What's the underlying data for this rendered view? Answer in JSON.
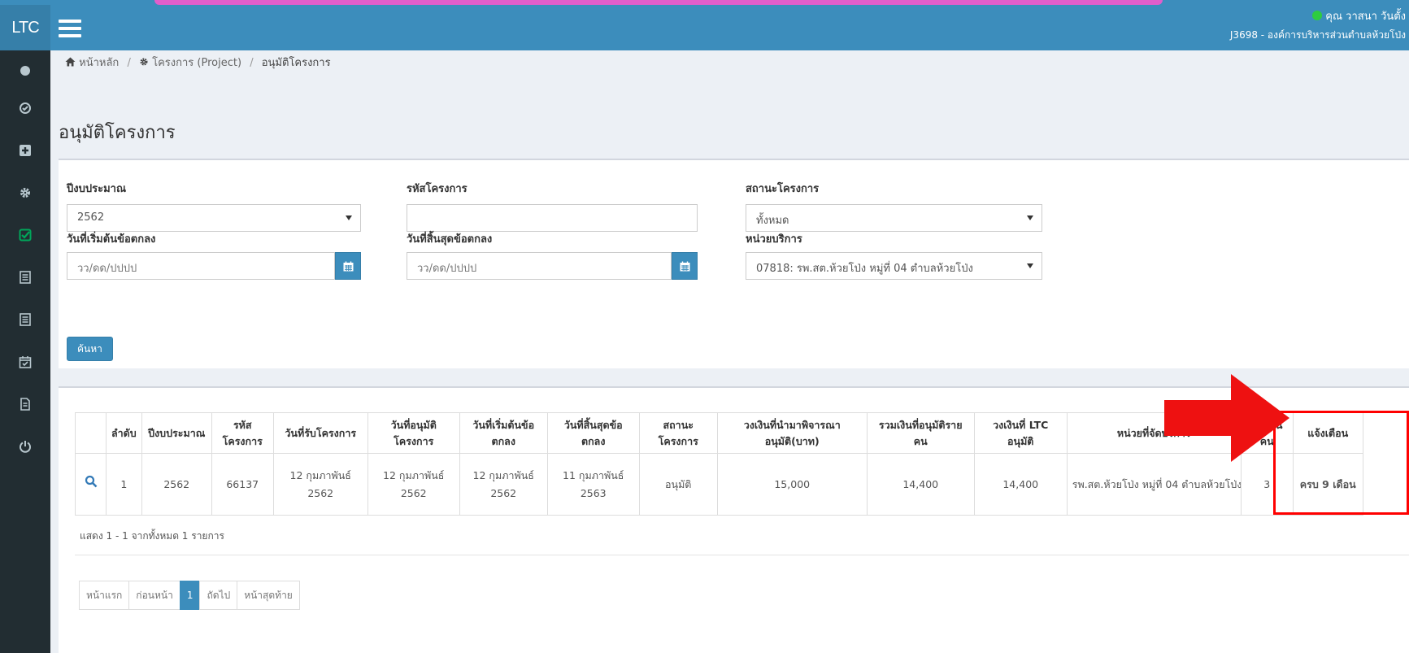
{
  "app": {
    "logo": "LTC"
  },
  "user": {
    "name": "คุณ วาสนา วันตั้ง",
    "org": "J3698 - องค์การบริหารส่วนตำบลห้วยโป่ง"
  },
  "sidebar": {
    "items": [
      {
        "icon": "circle-icon"
      },
      {
        "icon": "check-circle-icon"
      },
      {
        "icon": "plus-square-icon"
      },
      {
        "icon": "gear-icon"
      },
      {
        "icon": "check-square-icon",
        "active": true
      },
      {
        "icon": "list-icon"
      },
      {
        "icon": "list-alt-icon"
      },
      {
        "icon": "calendar-check-icon"
      },
      {
        "icon": "file-text-icon"
      },
      {
        "icon": "power-icon"
      }
    ]
  },
  "breadcrumb": {
    "home": "หน้าหลัก",
    "sep": "/",
    "project": "โครงการ (Project)",
    "current": "อนุมัติโครงการ"
  },
  "page": {
    "title": "อนุมัติโครงการ"
  },
  "filters": {
    "budget_year": {
      "label": "ปีงบประมาณ",
      "value": "2562"
    },
    "project_code": {
      "label": "รหัสโครงการ",
      "value": ""
    },
    "project_status": {
      "label": "สถานะโครงการ",
      "value": "ทั้งหมด"
    },
    "start_date": {
      "label": "วันที่เริ่มต้นข้อตกลง",
      "placeholder": "วว/ดด/ปปปป"
    },
    "end_date": {
      "label": "วันที่สิ้นสุดข้อตกลง",
      "placeholder": "วว/ดด/ปปปป"
    },
    "service_unit": {
      "label": "หน่วยบริการ",
      "value": "07818: รพ.สต.ห้วยโป่ง หมู่ที่ 04 ตำบลห้วยโป่ง"
    },
    "search_label": "ค้นหา"
  },
  "table": {
    "headers": {
      "no": "ลำดับ",
      "year": "ปีงบประมาณ",
      "code": "รหัสโครงการ",
      "received": "วันที่รับโครงการ",
      "approved": "วันที่อนุมัติโครงการ",
      "start": "วันที่เริ่มต้นข้อตกลง",
      "end": "วันที่สิ้นสุดข้อตกลง",
      "status": "สถานะโครงการ",
      "proposed": "วงเงินที่นำมาพิจารณาอนุมัติ(บาท)",
      "per_person": "รวมเงินที่อนุมัติรายคน",
      "ltc": "วงเงินที่ LTC อนุมัติ",
      "unit": "หน่วยที่จัดบริการ",
      "people": "จำนวนคน",
      "alert": "แจ้งเตือน"
    },
    "rows": [
      {
        "no": "1",
        "year": "2562",
        "code": "66137",
        "received": "12 กุมภาพันธ์ 2562",
        "approved_a": "12 กุมภาพันธ์",
        "approved_b": "2562",
        "start_a": "12 กุมภาพันธ์",
        "start_b": "2562",
        "end_a": "11 กุมภาพันธ์",
        "end_b": "2563",
        "status": "อนุมัติ",
        "proposed": "15,000",
        "per_person": "14,400",
        "ltc": "14,400",
        "unit": "รพ.สต.ห้วยโป่ง หมู่ที่ 04 ตำบลห้วยโป่ง",
        "people": "3",
        "alert": "ครบ 9 เดือน"
      }
    ],
    "summary": "แสดง 1 - 1 จากทั้งหมด 1 รายการ"
  },
  "pager": {
    "first": "หน้าแรก",
    "prev": "ก่อนหน้า",
    "current": "1",
    "next": "ถัดไป",
    "last": "หน้าสุดท้าย"
  },
  "colors": {
    "primary": "#3c8dbc",
    "sidebar": "#222d32",
    "alert": "#ff0000",
    "highlight_strip": "#e15ecb"
  }
}
